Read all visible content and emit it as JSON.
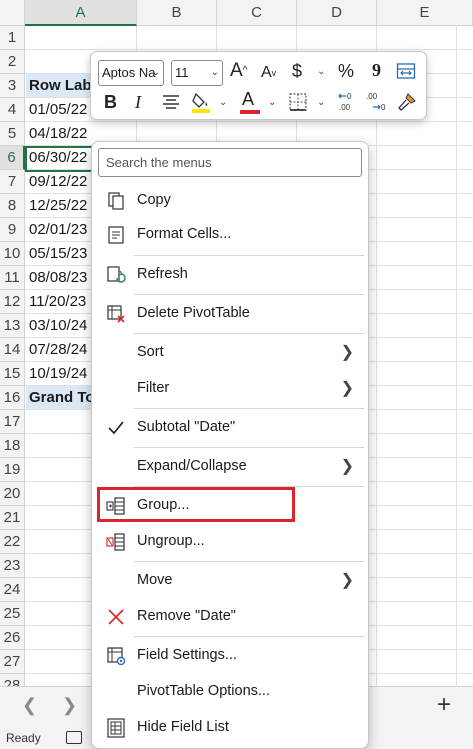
{
  "columns": [
    "A",
    "B",
    "C",
    "D",
    "E"
  ],
  "rows": [
    "1",
    "2",
    "3",
    "4",
    "5",
    "6",
    "7",
    "8",
    "9",
    "10",
    "11",
    "12",
    "13",
    "14",
    "15",
    "16",
    "17",
    "18",
    "19",
    "20",
    "21",
    "22",
    "23",
    "24",
    "25",
    "26",
    "27",
    "28"
  ],
  "cells": {
    "header": "Row Lab",
    "dates": [
      "01/05/22",
      "04/18/22",
      "06/30/22",
      "09/12/22",
      "12/25/22",
      "02/01/23",
      "05/15/23",
      "08/08/23",
      "11/20/23",
      "03/10/24",
      "07/28/24",
      "10/19/24"
    ],
    "grand_total": "Grand To"
  },
  "mini_toolbar": {
    "font_name": "Aptos Na",
    "font_size": "11",
    "grow_font": "A",
    "shrink_font": "A",
    "currency": "$",
    "percent": "%",
    "comma": "9",
    "bold": "B",
    "italic": "I",
    "font_color_letter": "A",
    "fill_color": "#ffe600",
    "font_color": "#d9262c"
  },
  "context_menu": {
    "search_placeholder": "Search the menus",
    "items": [
      {
        "label": "Copy"
      },
      {
        "label": "Format Cells..."
      },
      {
        "label": "Refresh"
      },
      {
        "label": "Delete PivotTable"
      },
      {
        "label": "Sort"
      },
      {
        "label": "Filter"
      },
      {
        "label": "Subtotal \"Date\""
      },
      {
        "label": "Expand/Collapse"
      },
      {
        "label": "Group..."
      },
      {
        "label": "Ungroup..."
      },
      {
        "label": "Move"
      },
      {
        "label": "Remove \"Date\""
      },
      {
        "label": "Field Settings..."
      },
      {
        "label": "PivotTable Options..."
      },
      {
        "label": "Hide Field List"
      }
    ],
    "checked": "Subtotal \"Date\"",
    "highlighted": "Group...",
    "highlight_color": "#d9262c"
  },
  "sheet_bar": {
    "add_sheet": "+"
  },
  "status_bar": {
    "ready": "Ready"
  }
}
